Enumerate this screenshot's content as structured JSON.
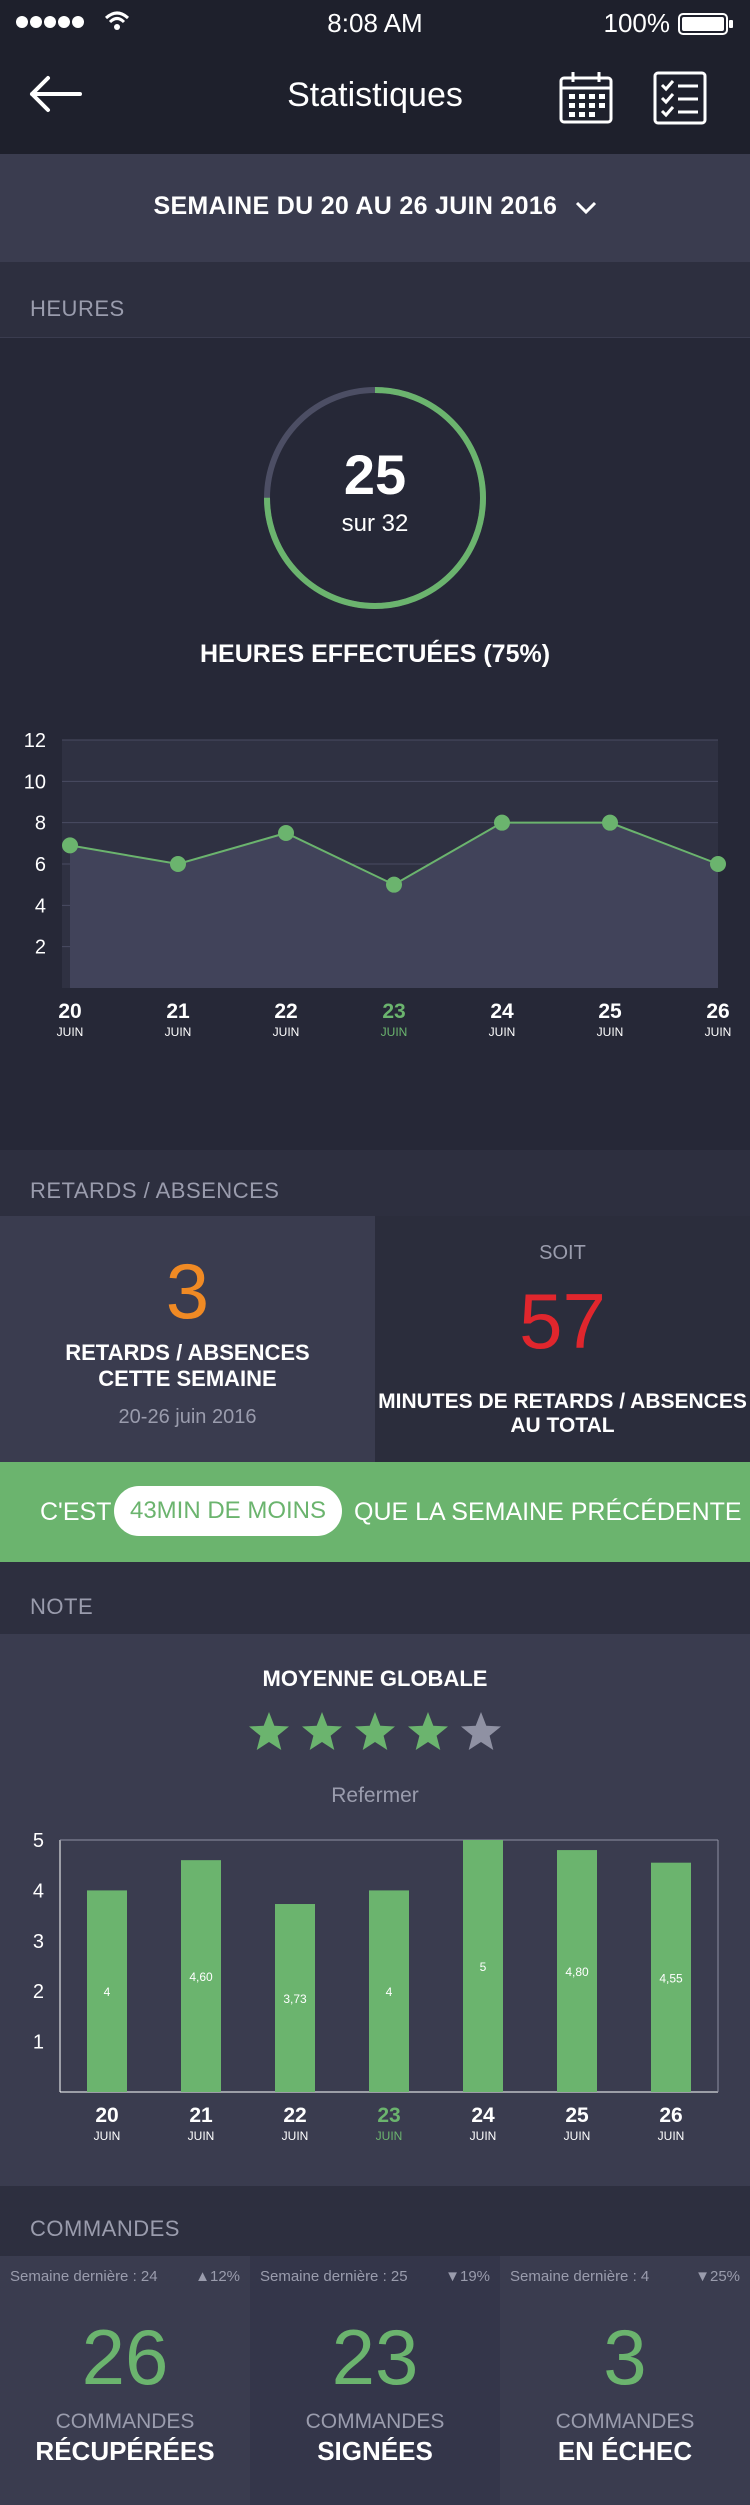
{
  "status_bar": {
    "time": "8:08 AM",
    "battery": "100%"
  },
  "header": {
    "title": "Statistiques"
  },
  "week": {
    "label": "SEMAINE DU 20 AU 26 JUIN 2016"
  },
  "hours": {
    "section_title": "HEURES",
    "done": "25",
    "total_label": "sur 32",
    "progress": 0.75,
    "caption": "HEURES EFFECTUÉES (75%)"
  },
  "hours_chart": {
    "type": "line",
    "x": [
      "20",
      "21",
      "22",
      "23",
      "24",
      "25",
      "26"
    ],
    "x_sub": "JUIN",
    "y": [
      6.9,
      6.0,
      7.5,
      5.0,
      8.0,
      8.0,
      6.0
    ],
    "yticks": [
      "2",
      "4",
      "6",
      "8",
      "10",
      "12"
    ],
    "ylim": [
      0,
      12
    ],
    "highlight_index": 3
  },
  "late": {
    "section_title": "RETARDS / ABSENCES",
    "count": "3",
    "count_label_1": "RETARDS / ABSENCES",
    "count_label_2": "CETTE SEMAINE",
    "date_range": "20-26 juin 2016",
    "soit": "SOIT",
    "minutes": "57",
    "minutes_label_1": "MINUTES DE RETARDS / ABSENCES",
    "minutes_label_2": "AU TOTAL"
  },
  "banner": {
    "prefix": "C'EST",
    "pill": "43MIN DE MOINS",
    "suffix": "QUE LA SEMAINE PRÉCÉDENTE"
  },
  "note": {
    "section_title": "NOTE",
    "avg_label": "MOYENNE GLOBALE",
    "stars": 4,
    "stars_max": 5,
    "toggle": "Refermer"
  },
  "chart_data": {
    "type": "bar",
    "categories": [
      "20",
      "21",
      "22",
      "23",
      "24",
      "25",
      "26"
    ],
    "x_sub": "JUIN",
    "values": [
      4,
      4.6,
      3.73,
      4,
      5,
      4.8,
      4.55
    ],
    "value_labels": [
      "4",
      "4,60",
      "3,73",
      "4",
      "5",
      "4,80",
      "4,55"
    ],
    "yticks": [
      "1",
      "2",
      "3",
      "4",
      "5"
    ],
    "ylim": [
      0,
      5
    ],
    "highlight_index": 3
  },
  "commands": {
    "section_title": "COMMANDES",
    "cards": [
      {
        "last_week": "Semaine dernière : 24",
        "delta": "▲12%",
        "value": "26",
        "label_1": "COMMANDES",
        "label_2": "RÉCUPÉRÉES"
      },
      {
        "last_week": "Semaine dernière : 25",
        "delta": "▼19%",
        "value": "23",
        "label_1": "COMMANDES",
        "label_2": "SIGNÉES"
      },
      {
        "last_week": "Semaine dernière : 4",
        "delta": "▼25%",
        "value": "3",
        "label_1": "COMMANDES",
        "label_2": "EN ÉCHEC"
      }
    ]
  },
  "colors": {
    "accent_green": "#6bb46e",
    "orange": "#f08a24",
    "red": "#e0262d",
    "bg_dark": "#262837",
    "bg_card": "#3a3c4f"
  }
}
